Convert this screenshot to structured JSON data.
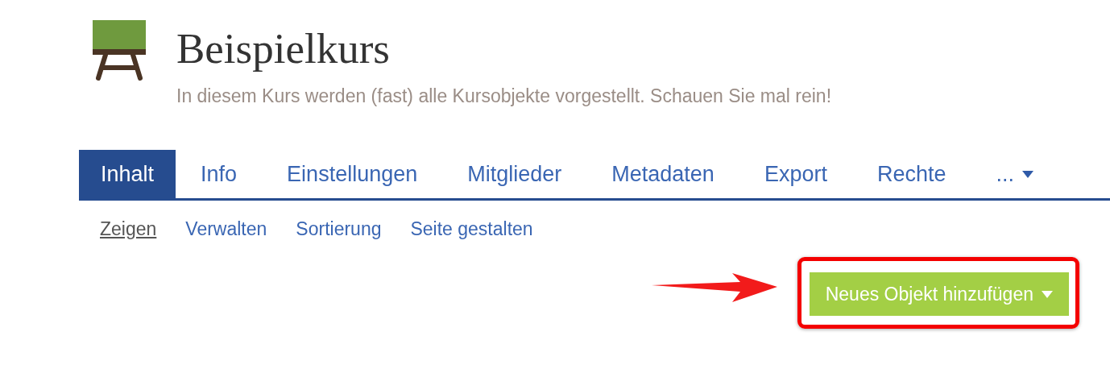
{
  "course": {
    "title": "Beispielkurs",
    "description": "In diesem Kurs werden (fast) alle Kursobjekte vorgestellt. Schauen Sie mal rein!"
  },
  "tabs": [
    {
      "label": "Inhalt",
      "selected": true
    },
    {
      "label": "Info",
      "selected": false
    },
    {
      "label": "Einstellungen",
      "selected": false
    },
    {
      "label": "Mitglieder",
      "selected": false
    },
    {
      "label": "Metadaten",
      "selected": false
    },
    {
      "label": "Export",
      "selected": false
    },
    {
      "label": "Rechte",
      "selected": false
    },
    {
      "label": "...",
      "selected": false,
      "kind": "more"
    }
  ],
  "subtabs": [
    {
      "label": "Zeigen",
      "selected": true
    },
    {
      "label": "Verwalten",
      "selected": false
    },
    {
      "label": "Sortierung",
      "selected": false
    },
    {
      "label": "Seite gestalten",
      "selected": false
    }
  ],
  "add_button": {
    "label": "Neues Objekt hinzufügen"
  }
}
